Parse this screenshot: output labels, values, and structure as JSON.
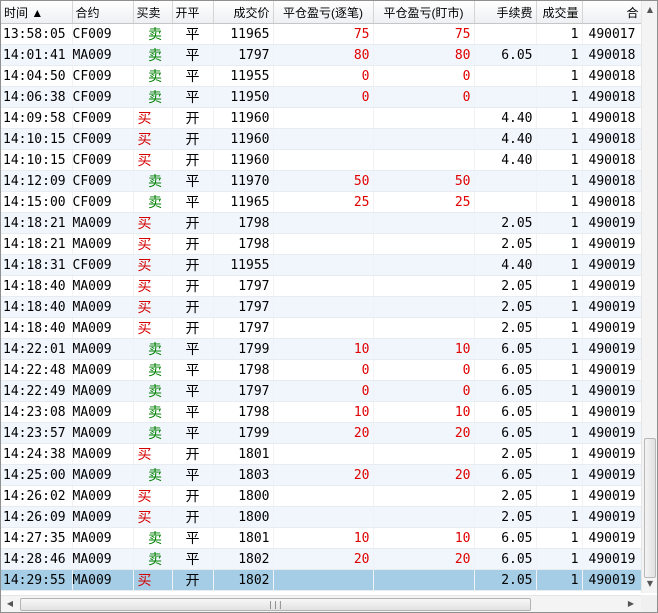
{
  "columns": [
    "时间 ▲",
    "合约",
    "买卖",
    "开平",
    "成交价",
    "平仓盈亏(逐笔)",
    "平仓盈亏(盯市)",
    "手续费",
    "成交量",
    "合"
  ],
  "rows": [
    {
      "time": "13:58:05",
      "code": "CF009",
      "dir": "卖",
      "oc": "平",
      "price": "11965",
      "pnl1": "75",
      "pnl2": "75",
      "fee": "",
      "qty": "1",
      "id": "490017"
    },
    {
      "time": "14:01:41",
      "code": "MA009",
      "dir": "卖",
      "oc": "平",
      "price": "1797",
      "pnl1": "80",
      "pnl2": "80",
      "fee": "6.05",
      "qty": "1",
      "id": "490018"
    },
    {
      "time": "14:04:50",
      "code": "CF009",
      "dir": "卖",
      "oc": "平",
      "price": "11955",
      "pnl1": "0",
      "pnl2": "0",
      "fee": "",
      "qty": "1",
      "id": "490018"
    },
    {
      "time": "14:06:38",
      "code": "CF009",
      "dir": "卖",
      "oc": "平",
      "price": "11950",
      "pnl1": "0",
      "pnl2": "0",
      "fee": "",
      "qty": "1",
      "id": "490018"
    },
    {
      "time": "14:09:58",
      "code": "CF009",
      "dir": "买",
      "oc": "开",
      "price": "11960",
      "pnl1": "",
      "pnl2": "",
      "fee": "4.40",
      "qty": "1",
      "id": "490018"
    },
    {
      "time": "14:10:15",
      "code": "CF009",
      "dir": "买",
      "oc": "开",
      "price": "11960",
      "pnl1": "",
      "pnl2": "",
      "fee": "4.40",
      "qty": "1",
      "id": "490018"
    },
    {
      "time": "14:10:15",
      "code": "CF009",
      "dir": "买",
      "oc": "开",
      "price": "11960",
      "pnl1": "",
      "pnl2": "",
      "fee": "4.40",
      "qty": "1",
      "id": "490018"
    },
    {
      "time": "14:12:09",
      "code": "CF009",
      "dir": "卖",
      "oc": "平",
      "price": "11970",
      "pnl1": "50",
      "pnl2": "50",
      "fee": "",
      "qty": "1",
      "id": "490018"
    },
    {
      "time": "14:15:00",
      "code": "CF009",
      "dir": "卖",
      "oc": "平",
      "price": "11965",
      "pnl1": "25",
      "pnl2": "25",
      "fee": "",
      "qty": "1",
      "id": "490018"
    },
    {
      "time": "14:18:21",
      "code": "MA009",
      "dir": "买",
      "oc": "开",
      "price": "1798",
      "pnl1": "",
      "pnl2": "",
      "fee": "2.05",
      "qty": "1",
      "id": "490019"
    },
    {
      "time": "14:18:21",
      "code": "MA009",
      "dir": "买",
      "oc": "开",
      "price": "1798",
      "pnl1": "",
      "pnl2": "",
      "fee": "2.05",
      "qty": "1",
      "id": "490019"
    },
    {
      "time": "14:18:31",
      "code": "CF009",
      "dir": "买",
      "oc": "开",
      "price": "11955",
      "pnl1": "",
      "pnl2": "",
      "fee": "4.40",
      "qty": "1",
      "id": "490019"
    },
    {
      "time": "14:18:40",
      "code": "MA009",
      "dir": "买",
      "oc": "开",
      "price": "1797",
      "pnl1": "",
      "pnl2": "",
      "fee": "2.05",
      "qty": "1",
      "id": "490019"
    },
    {
      "time": "14:18:40",
      "code": "MA009",
      "dir": "买",
      "oc": "开",
      "price": "1797",
      "pnl1": "",
      "pnl2": "",
      "fee": "2.05",
      "qty": "1",
      "id": "490019"
    },
    {
      "time": "14:18:40",
      "code": "MA009",
      "dir": "买",
      "oc": "开",
      "price": "1797",
      "pnl1": "",
      "pnl2": "",
      "fee": "2.05",
      "qty": "1",
      "id": "490019"
    },
    {
      "time": "14:22:01",
      "code": "MA009",
      "dir": "卖",
      "oc": "平",
      "price": "1799",
      "pnl1": "10",
      "pnl2": "10",
      "fee": "6.05",
      "qty": "1",
      "id": "490019"
    },
    {
      "time": "14:22:48",
      "code": "MA009",
      "dir": "卖",
      "oc": "平",
      "price": "1798",
      "pnl1": "0",
      "pnl2": "0",
      "fee": "6.05",
      "qty": "1",
      "id": "490019"
    },
    {
      "time": "14:22:49",
      "code": "MA009",
      "dir": "卖",
      "oc": "平",
      "price": "1797",
      "pnl1": "0",
      "pnl2": "0",
      "fee": "6.05",
      "qty": "1",
      "id": "490019"
    },
    {
      "time": "14:23:08",
      "code": "MA009",
      "dir": "卖",
      "oc": "平",
      "price": "1798",
      "pnl1": "10",
      "pnl2": "10",
      "fee": "6.05",
      "qty": "1",
      "id": "490019"
    },
    {
      "time": "14:23:57",
      "code": "MA009",
      "dir": "卖",
      "oc": "平",
      "price": "1799",
      "pnl1": "20",
      "pnl2": "20",
      "fee": "6.05",
      "qty": "1",
      "id": "490019"
    },
    {
      "time": "14:24:38",
      "code": "MA009",
      "dir": "买",
      "oc": "开",
      "price": "1801",
      "pnl1": "",
      "pnl2": "",
      "fee": "2.05",
      "qty": "1",
      "id": "490019"
    },
    {
      "time": "14:25:00",
      "code": "MA009",
      "dir": "卖",
      "oc": "平",
      "price": "1803",
      "pnl1": "20",
      "pnl2": "20",
      "fee": "6.05",
      "qty": "1",
      "id": "490019"
    },
    {
      "time": "14:26:02",
      "code": "MA009",
      "dir": "买",
      "oc": "开",
      "price": "1800",
      "pnl1": "",
      "pnl2": "",
      "fee": "2.05",
      "qty": "1",
      "id": "490019"
    },
    {
      "time": "14:26:09",
      "code": "MA009",
      "dir": "买",
      "oc": "开",
      "price": "1800",
      "pnl1": "",
      "pnl2": "",
      "fee": "2.05",
      "qty": "1",
      "id": "490019"
    },
    {
      "time": "14:27:35",
      "code": "MA009",
      "dir": "卖",
      "oc": "平",
      "price": "1801",
      "pnl1": "10",
      "pnl2": "10",
      "fee": "6.05",
      "qty": "1",
      "id": "490019"
    },
    {
      "time": "14:28:46",
      "code": "MA009",
      "dir": "卖",
      "oc": "平",
      "price": "1802",
      "pnl1": "20",
      "pnl2": "20",
      "fee": "6.05",
      "qty": "1",
      "id": "490019"
    },
    {
      "time": "14:29:55",
      "code": "MA009",
      "dir": "买",
      "oc": "开",
      "price": "1802",
      "pnl1": "",
      "pnl2": "",
      "fee": "2.05",
      "qty": "1",
      "id": "490019"
    }
  ],
  "selected_row": 26,
  "scrollbar": {
    "grip_glyph": "|||",
    "up_arrow": "▲",
    "down_arrow": "▼",
    "left_arrow": "◀",
    "right_arrow": "▶"
  },
  "colors": {
    "buy": "#d40000",
    "sell": "#008000",
    "pnl": "#e00000",
    "selected": "#a6cde6",
    "alt_row": "#f1f6fd"
  }
}
